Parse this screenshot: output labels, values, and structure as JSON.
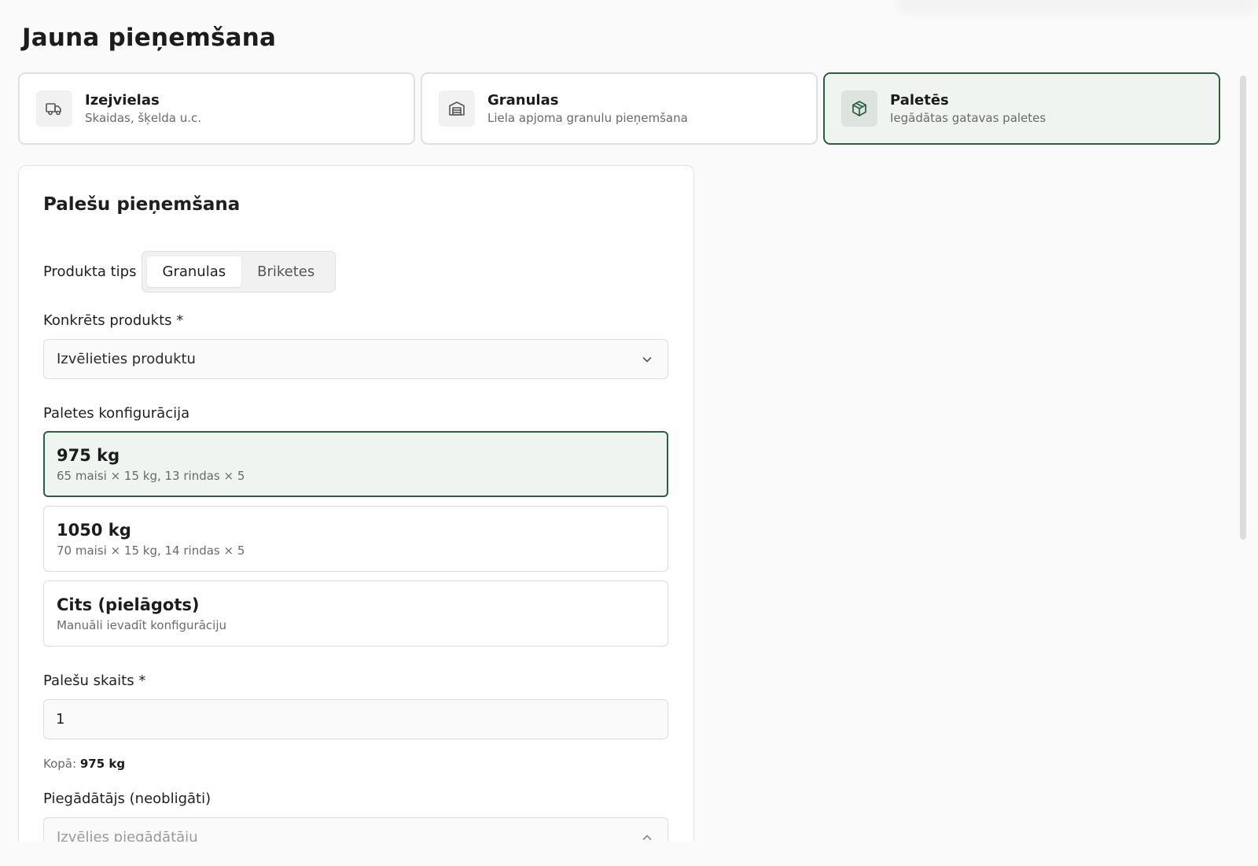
{
  "page": {
    "title": "Jauna pieņemšana"
  },
  "types": [
    {
      "title": "Izejvielas",
      "subtitle": "Skaidas, šķelda u.c.",
      "icon": "truck-icon",
      "active": false
    },
    {
      "title": "Granulas",
      "subtitle": "Liela apjoma granulu pieņemšana",
      "icon": "warehouse-icon",
      "active": false
    },
    {
      "title": "Paletēs",
      "subtitle": "Iegādātas gatavas paletes",
      "icon": "package-icon",
      "active": true
    }
  ],
  "form": {
    "title": "Palešu pieņemšana",
    "product_type": {
      "label": "Produkta tips",
      "options": [
        "Granulas",
        "Briketes"
      ],
      "selected": "Granulas"
    },
    "product": {
      "label": "Konkrēts produkts *",
      "placeholder": "Izvēlieties produktu"
    },
    "pallet_config": {
      "label": "Paletes konfigurācija",
      "options": [
        {
          "weight": "975 kg",
          "desc": "65 maisi × 15 kg, 13 rindas × 5",
          "selected": true
        },
        {
          "weight": "1050 kg",
          "desc": "70 maisi × 15 kg, 14 rindas × 5",
          "selected": false
        },
        {
          "weight": "Cits (pielāgots)",
          "desc": "Manuāli ievadīt konfigurāciju",
          "selected": false
        }
      ]
    },
    "pallet_count": {
      "label": "Palešu skaits *",
      "value": "1",
      "total_label": "Kopā:",
      "total_value": "975 kg"
    },
    "supplier": {
      "label": "Piegādātājs (neobligāti)",
      "placeholder": "Izvēlies piegādātāju"
    }
  },
  "colors": {
    "accent": "#2e5d3f",
    "accent_bg": "#f0f4f1",
    "background": "#fafafa"
  }
}
